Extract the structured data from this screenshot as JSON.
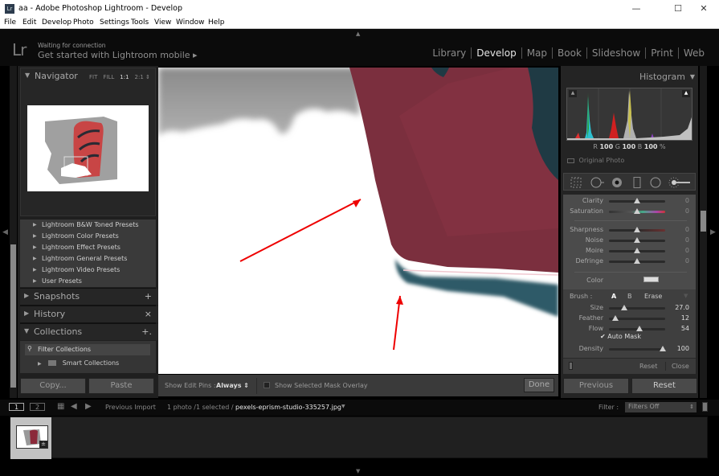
{
  "window": {
    "title": "aa - Adobe Photoshop Lightroom - Develop",
    "app_icon": "Lr",
    "minimize": "—",
    "maximize": "☐",
    "close": "✕"
  },
  "menu": [
    "File",
    "Edit",
    "Develop",
    "Photo",
    "Settings",
    "Tools",
    "View",
    "Window",
    "Help"
  ],
  "identity": {
    "logo": "Lr",
    "status": "Waiting for connection",
    "mobile_link": "Get started with Lightroom mobile ▸"
  },
  "modules": [
    {
      "label": "Library",
      "active": false
    },
    {
      "label": "Develop",
      "active": true
    },
    {
      "label": "Map",
      "active": false
    },
    {
      "label": "Book",
      "active": false
    },
    {
      "label": "Slideshow",
      "active": false
    },
    {
      "label": "Print",
      "active": false
    },
    {
      "label": "Web",
      "active": false
    }
  ],
  "left": {
    "navigator": {
      "title": "Navigator",
      "zoom_options": [
        "FIT",
        "FILL",
        "1:1",
        "2:1 ⇕"
      ],
      "active_zoom": "1:1"
    },
    "presets": [
      "Lightroom B&W Toned Presets",
      "Lightroom Color Presets",
      "Lightroom Effect Presets",
      "Lightroom General Presets",
      "Lightroom Video Presets",
      "User Presets"
    ],
    "snapshots": {
      "title": "Snapshots",
      "action": "+"
    },
    "history": {
      "title": "History",
      "action": "×"
    },
    "collections": {
      "title": "Collections",
      "action": "+.",
      "filter": "Filter Collections",
      "smart": "Smart Collections"
    },
    "copy_button": "Copy...",
    "paste_button": "Paste"
  },
  "toolbar": {
    "edit_pins_label": "Show Edit Pins :",
    "edit_pins_value": "Always ⇕",
    "mask_overlay_label": "Show Selected Mask Overlay",
    "mask_overlay_checked": false,
    "done_button": "Done"
  },
  "right": {
    "histogram": {
      "title": "Histogram",
      "readout": {
        "R_label": "R",
        "R": "100",
        "G_label": "G",
        "G": "100",
        "B_label": "B",
        "B": "100",
        "unit": "%"
      },
      "original_photo": "Original Photo"
    },
    "tools": [
      "crop-overlay",
      "spot-removal",
      "red-eye",
      "graduated-filter",
      "radial-filter",
      "adjustment-brush"
    ],
    "adjustments": [
      {
        "label": "Clarity",
        "value": "0",
        "pos": 0.5
      },
      {
        "label": "Saturation",
        "value": "0",
        "pos": 0.5
      },
      {
        "label": "Sharpness",
        "value": "0",
        "pos": 0.5
      },
      {
        "label": "Noise",
        "value": "0",
        "pos": 0.5
      },
      {
        "label": "Moire",
        "value": "0",
        "pos": 0.5
      },
      {
        "label": "Defringe",
        "value": "0",
        "pos": 0.5
      }
    ],
    "color_label": "Color",
    "brush": {
      "label": "Brush :",
      "tabs": [
        "A",
        "B",
        "Erase"
      ],
      "active_tab": "A",
      "sliders": [
        {
          "label": "Size",
          "value": "27.0",
          "pos": 0.27
        },
        {
          "label": "Feather",
          "value": "12",
          "pos": 0.12
        },
        {
          "label": "Flow",
          "value": "54",
          "pos": 0.54
        },
        {
          "label": "Density",
          "value": "100",
          "pos": 0.95
        }
      ],
      "auto_mask_label": "Auto Mask",
      "auto_mask_checked": true
    },
    "reset_label": "Reset",
    "close_label": "Close",
    "previous_button": "Previous",
    "reset_button": "Reset"
  },
  "filmstrip": {
    "page1": "1",
    "page2": "2",
    "source": "Previous Import",
    "count": "1 photo /1 selected /",
    "filename": "pexels-eprism-studio-335257.jpg",
    "filter_label": "Filter :",
    "filter_value": "Filters Off"
  }
}
